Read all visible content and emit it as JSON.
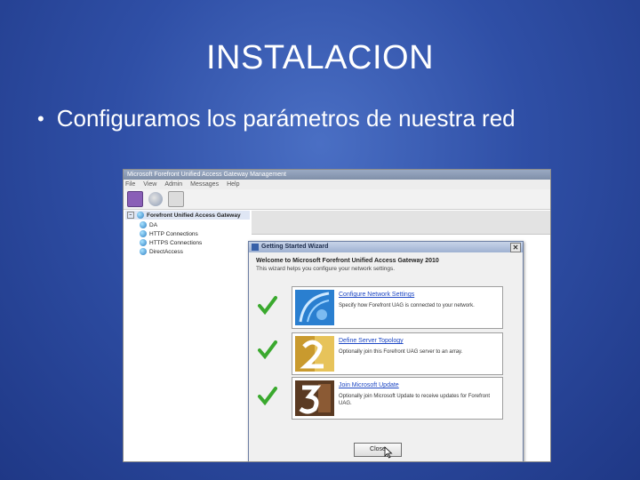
{
  "slide": {
    "title": "INSTALACION",
    "bullet": "Configuramos los parámetros de nuestra red"
  },
  "console": {
    "window_title": "Microsoft Forefront Unified Access Gateway Management",
    "menu": [
      "File",
      "View",
      "Admin",
      "Messages",
      "Help"
    ],
    "tree": {
      "root": "Forefront Unified Access Gateway",
      "children": [
        "DA",
        "HTTP Connections",
        "HTTPS Connections",
        "DirectAccess"
      ]
    }
  },
  "wizard": {
    "title": "Getting Started Wizard",
    "close_glyph": "✕",
    "welcome": "Welcome to Microsoft Forefront Unified Access Gateway 2010",
    "description": "This wizard helps you configure your network settings.",
    "tasks": [
      {
        "link": "Configure Network Settings",
        "desc": "Specify how Forefront UAG is connected to your network.",
        "image_icon": "network-icon",
        "status_icon": "checkmark-icon"
      },
      {
        "link": "Define Server Topology",
        "desc": "Optionally join this Forefront UAG server to an array.",
        "image_icon": "number-2-icon",
        "status_icon": "checkmark-icon"
      },
      {
        "link": "Join Microsoft Update",
        "desc": "Optionally join Microsoft Update to receive updates for Forefront UAG.",
        "image_icon": "number-3-icon",
        "status_icon": "checkmark-icon"
      }
    ],
    "close_button": "Close"
  },
  "colors": {
    "background": "#2f4fa6",
    "link": "#1d47c4",
    "check": "#3aa92e"
  }
}
